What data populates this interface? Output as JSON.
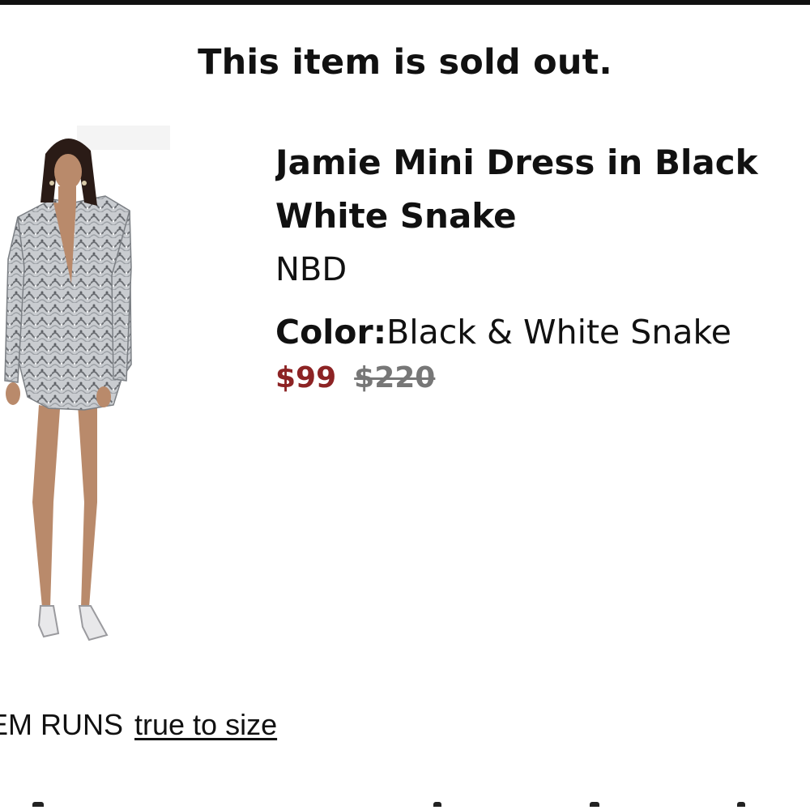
{
  "banner": {
    "sold_out_message": "This item is sold out."
  },
  "product": {
    "title_line1": "Jamie Mini Dress in Black",
    "title_line2": "White Snake",
    "brand": "NBD",
    "color_label": "Color:",
    "color_value": "Black & White Snake",
    "price_sale": "$99",
    "price_original": "$220",
    "sale_color": "#8d2324"
  },
  "fit": {
    "label": "EM RUNS",
    "value_link": "true to size"
  }
}
